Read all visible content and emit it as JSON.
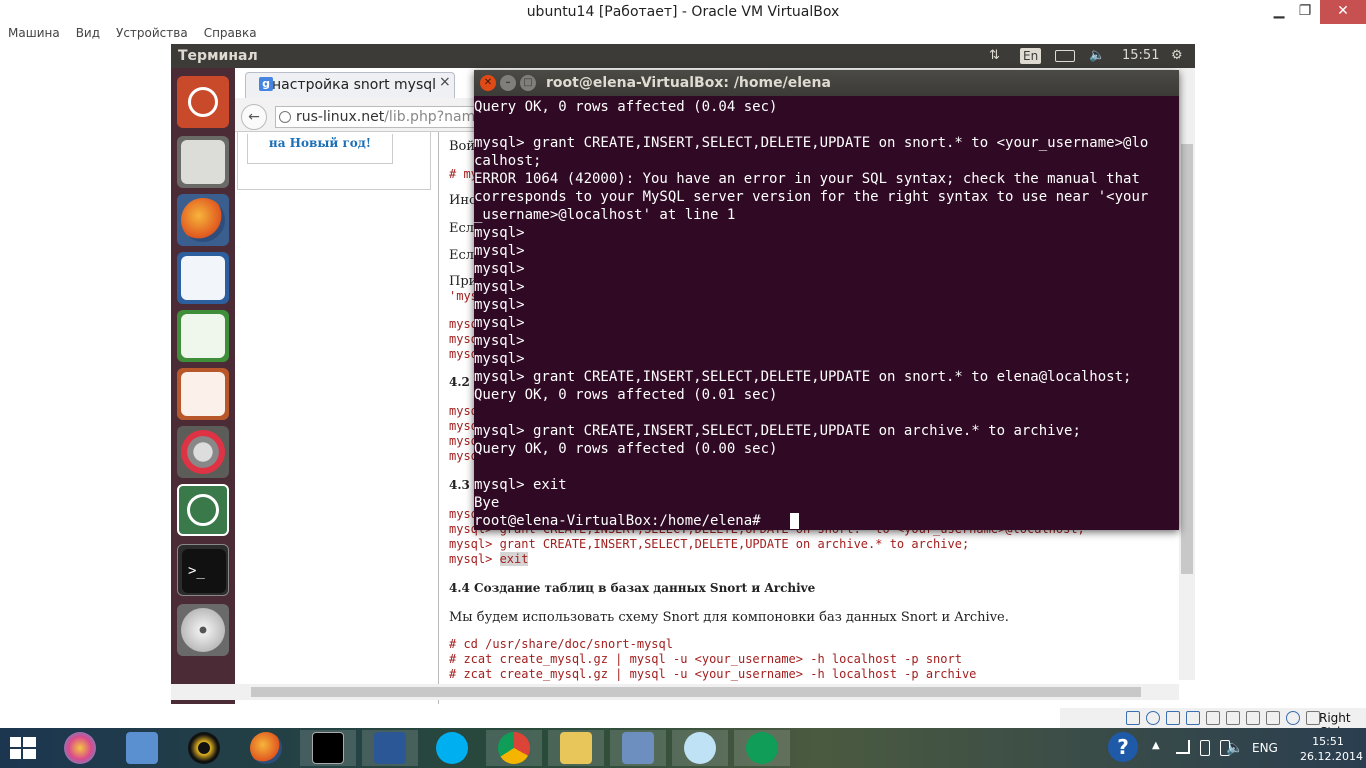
{
  "host_window": {
    "title": "ubuntu14 [Работает] - Oracle VM VirtualBox",
    "minimize": "▁",
    "maximize": "❐",
    "close": "✕",
    "menu": [
      "Машина",
      "Вид",
      "Устройства",
      "Справка"
    ]
  },
  "ubuntu_panel": {
    "title": "Терминал",
    "network_icon": "⇅",
    "lang": "En",
    "battery_icon": "▭",
    "volume_icon": "🔈",
    "time": "15:51",
    "power_icon": "⚙"
  },
  "launcher": {
    "items": [
      "dash",
      "files",
      "firefox",
      "writer",
      "calc",
      "impress",
      "settings",
      "updater",
      "terminal",
      "dvd"
    ]
  },
  "browser": {
    "tab_icon": "g",
    "tab_title": "настройка snort mysql",
    "tab_close": "×",
    "back_icon": "←",
    "url_host": "rus-linux.net",
    "url_path": "/lib.php?name",
    "sidebar_link_line1": "на Новый год!",
    "page": {
      "voy": "Вой",
      "my": "# my",
      "ino": "Ино",
      "esl1": "Есл",
      "esl2": "Есл",
      "pri": "При",
      "mys_q": "'mys",
      "code_a": [
        "mysq",
        "mysq",
        "mysq"
      ],
      "h42": "4.2",
      "code_b": [
        "mysq",
        "mysq",
        "mysq",
        "mysq"
      ],
      "h43": "4.3",
      "code_c": [
        "mysq"
      ],
      "line_grant_partial": "mysql> grant CREATE,INSERT,SELECT,DELETE,UPDATE on snort.* to <your_username>@localhost;",
      "line_grant_archive": "mysql> grant CREATE,INSERT,SELECT,DELETE,UPDATE on archive.* to archive;",
      "line_exit_prompt": "mysql> ",
      "line_exit_cmd": "exit",
      "h44": "4.4 Создание таблиц в базах данных Snort и Archive",
      "para44": "Мы будем использовать схему Snort для компоновки баз данных Snort и Archive.",
      "cmds": [
        "# cd /usr/share/doc/snort-mysql",
        "# zcat create_mysql.gz | mysql  -u <your_username> -h localhost -p snort",
        "# zcat create_mysql.gz | mysql -u <your_username> -h localhost -p archive"
      ]
    }
  },
  "terminal": {
    "title": "root@elena-VirtualBox: /home/elena",
    "close_icon": "✕",
    "min_icon": "–",
    "max_icon": "□",
    "lines": [
      "Query OK, 0 rows affected (0.04 sec)",
      "",
      "mysql> grant CREATE,INSERT,SELECT,DELETE,UPDATE on snort.* to <your_username>@lo",
      "calhost;",
      "ERROR 1064 (42000): You have an error in your SQL syntax; check the manual that",
      "corresponds to your MySQL server version for the right syntax to use near '<your",
      "_username>@localhost' at line 1",
      "mysql>",
      "mysql>",
      "mysql>",
      "mysql>",
      "mysql>",
      "mysql>",
      "mysql>",
      "mysql>",
      "mysql> grant CREATE,INSERT,SELECT,DELETE,UPDATE on snort.* to elena@localhost;",
      "Query OK, 0 rows affected (0.01 sec)",
      "",
      "mysql> grant CREATE,INSERT,SELECT,DELETE,UPDATE on archive.* to archive;",
      "Query OK, 0 rows affected (0.00 sec)",
      "",
      "mysql> exit",
      "Bye",
      "root@elena-VirtualBox:/home/elena# "
    ]
  },
  "vb_status": {
    "host_key": "Right Ctrl"
  },
  "taskbar": {
    "items": [
      "paint",
      "calculator",
      "daemon-tools",
      "firefox",
      "cmd",
      "word",
      "skype",
      "chrome",
      "explorer",
      "virtualbox",
      "viewer",
      "hangouts"
    ],
    "lang": "ENG",
    "time": "15:51",
    "date": "26.12.2014",
    "help_icon": "?",
    "arrow_icon": "▲"
  },
  "colors": {
    "terminal_bg": "#300a24",
    "launcher_bg": "#4a2b36",
    "panel_bg": "#3c3b37",
    "code_red": "#a32020"
  }
}
